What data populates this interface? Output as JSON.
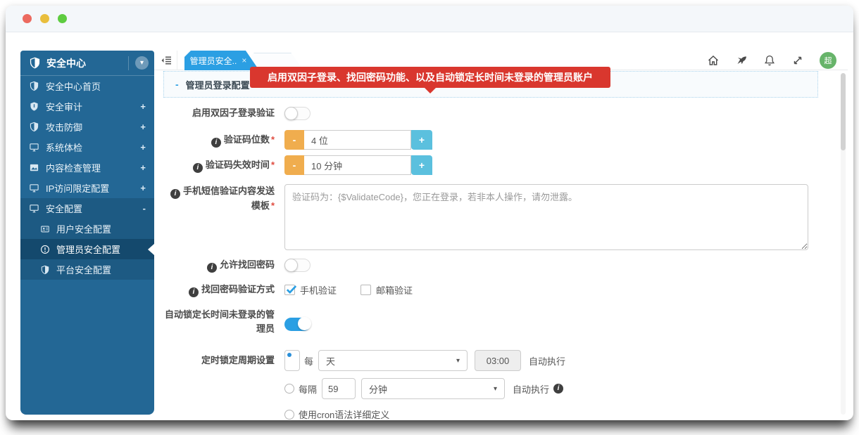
{
  "sidebar": {
    "title": "安全中心",
    "items": [
      {
        "label": "安全中心首页",
        "badge": ""
      },
      {
        "label": "安全审计",
        "badge": "+"
      },
      {
        "label": "攻击防御",
        "badge": "+"
      },
      {
        "label": "系统体检",
        "badge": "+"
      },
      {
        "label": "内容检查管理",
        "badge": "+"
      },
      {
        "label": "IP访问限定配置",
        "badge": "+"
      },
      {
        "label": "安全配置",
        "badge": "-"
      }
    ],
    "subitems": [
      {
        "label": "用户安全配置"
      },
      {
        "label": "管理员安全配置"
      },
      {
        "label": "平台安全配置"
      }
    ]
  },
  "tabbar": {
    "active_tab": "管理员安全.."
  },
  "topbar": {
    "avatar": "超"
  },
  "tooltip": {
    "text": "启用双因子登录、找回密码功能、以及自动锁定长时间未登录的管理员账户"
  },
  "section": {
    "title": "管理员登录配置"
  },
  "form": {
    "two_factor": {
      "label": "启用双因子登录验证"
    },
    "code_digits": {
      "label": "验证码位数",
      "required": "*",
      "value": "4 位"
    },
    "code_expiry": {
      "label": "验证码失效时间",
      "required": "*",
      "value": "10 分钟"
    },
    "sms_template": {
      "label": "手机短信验证内容发送模板",
      "required": "*",
      "value": "验证码为：{$ValidateCode}，您正在登录，若非本人操作，请勿泄露。"
    },
    "allow_recovery": {
      "label": "允许找回密码"
    },
    "recovery_methods": {
      "label": "找回密码验证方式",
      "phone": "手机验证",
      "email": "邮箱验证"
    },
    "auto_lock": {
      "label": "自动锁定长时间未登录的管理员"
    },
    "lock_schedule": {
      "label": "定时锁定周期设置",
      "every_prefix": "每",
      "every_unit": "天",
      "every_time": "03:00",
      "every_suffix": "自动执行",
      "interval_prefix": "每隔",
      "interval_value": "59",
      "interval_unit": "分钟",
      "interval_suffix": "自动执行",
      "cron_label": "使用cron语法详细定义"
    }
  },
  "icons": {
    "close": "×",
    "minus": "-",
    "plus": "+",
    "caret": "▾",
    "chevron": "▾",
    "info": "i",
    "collapse_marker": "-"
  },
  "colors": {
    "sidebar": "#236795",
    "sidebar_group": "#1d5a83",
    "sidebar_active": "#14496d",
    "tab_blue": "#2b9fe3",
    "tooltip_red": "#d9372e",
    "toggle_on": "#2b9fe3",
    "stepper_minus": "#f0ad4e",
    "stepper_plus": "#5bc0de",
    "avatar_green": "#67b46a"
  }
}
